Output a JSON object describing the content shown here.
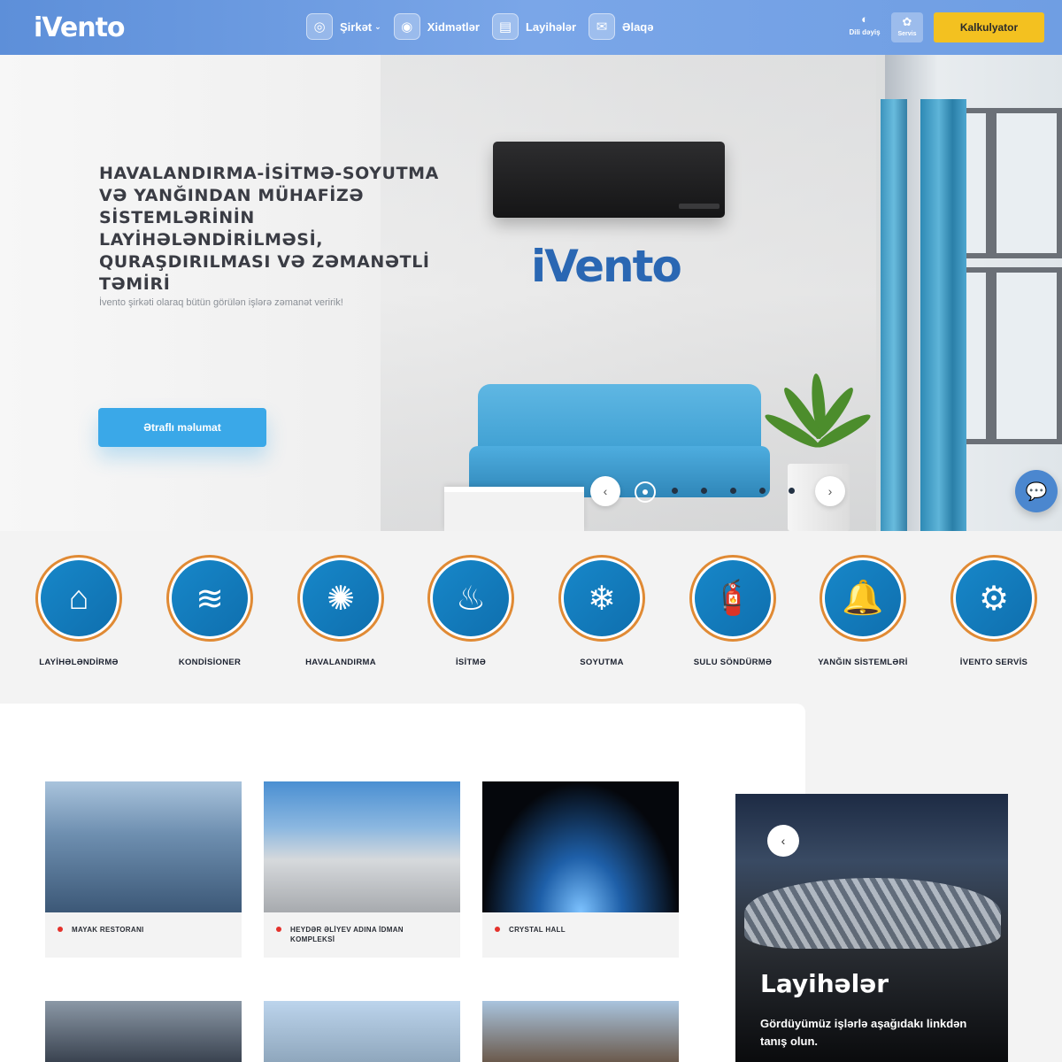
{
  "header": {
    "logo": "iVento",
    "nav": [
      {
        "label": "Şirkət",
        "icon": "compass-icon",
        "glyph": "◎",
        "dropdown": true
      },
      {
        "label": "Xidmətlər",
        "icon": "target-icon",
        "glyph": "◉",
        "dropdown": false
      },
      {
        "label": "Layihələr",
        "icon": "blueprint-icon",
        "glyph": "▤",
        "dropdown": false
      },
      {
        "label": "Əlaqə",
        "icon": "mail-icon",
        "glyph": "✉",
        "dropdown": false
      }
    ],
    "language_label": "Dili dəyiş",
    "servis_label": "Servis",
    "calculator_label": "Kalkulyator"
  },
  "hero": {
    "title": "HAVALANDIRMA-İSİTMƏ-SOYUTMA VƏ YANĞINDAN MÜHAFİZƏ SİSTEMLƏRİNİN LAYİHƏLƏNDİRİLMƏSİ, QURAŞDIRILMASI VƏ ZƏMANƏTLİ TƏMİRİ",
    "subtitle": "İvento şirkəti olaraq bütün görülən işlərə zəmanət veririk!",
    "button_label": "Ətraflı məlumat",
    "brand_logo": "iVento",
    "slide_count": 6,
    "active_slide": 1
  },
  "services": [
    {
      "label": "LAYİHƏLƏNDİRMƏ",
      "icon": "drafting-compass-icon",
      "glyph": "⌂"
    },
    {
      "label": "KONDİSİONER",
      "icon": "air-conditioner-icon",
      "glyph": "≋"
    },
    {
      "label": "HAVALANDIRMA",
      "icon": "fan-icon",
      "glyph": "✺"
    },
    {
      "label": "İSİTMƏ",
      "icon": "radiator-icon",
      "glyph": "♨"
    },
    {
      "label": "SOYUTMA",
      "icon": "snowflake-icon",
      "glyph": "❄"
    },
    {
      "label": "SULU SÖNDÜRMƏ",
      "icon": "fire-extinguisher-icon",
      "glyph": "🧯"
    },
    {
      "label": "YANĞIN SİSTEMLƏRİ",
      "icon": "alarm-bell-icon",
      "glyph": "🔔"
    },
    {
      "label": "İVENTO SERVİS",
      "icon": "gears-icon",
      "glyph": "⚙"
    }
  ],
  "projects": [
    {
      "name": "MAYAK RESTORANI"
    },
    {
      "name": "HEYDƏR ƏLİYEV ADINA İDMAN KOMPLEKSİ"
    },
    {
      "name": "CRYSTAL HALL"
    },
    {
      "name": ""
    },
    {
      "name": ""
    },
    {
      "name": ""
    }
  ],
  "promo": {
    "title": "Layihələr",
    "text": "Gördüyümüz işlərlə aşağıdakı linkdən tanış olun."
  },
  "colors": {
    "header": "#6f9ee3",
    "accent_yellow": "#f3c120",
    "accent_blue": "#3aa8e8",
    "service_blue": "#1787c9",
    "service_ring": "#e08a34",
    "bullet_red": "#e4312b"
  }
}
